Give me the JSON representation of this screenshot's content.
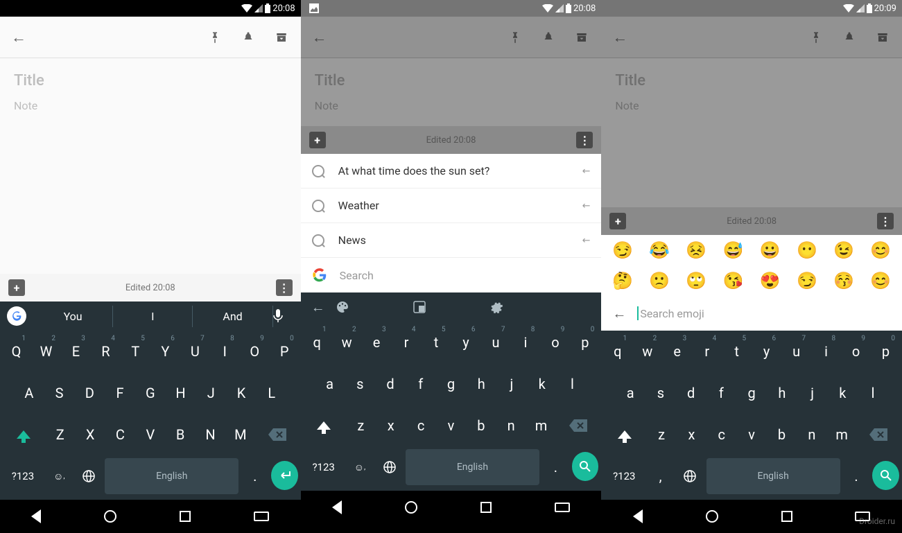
{
  "status": {
    "time1": "20:08",
    "time2": "20:08",
    "time3": "20:09"
  },
  "note": {
    "title": "Title",
    "body": "Note",
    "edited": "Edited 20:08"
  },
  "suggestions": {
    "items": [
      "At what time does the sun set?",
      "Weather",
      "News"
    ],
    "search_placeholder": "Search"
  },
  "emoji": {
    "row1": [
      "😏",
      "😂",
      "😣",
      "😅",
      "😀",
      "😶",
      "😉",
      "😊"
    ],
    "row2": [
      "🤔",
      "🙁",
      "🙄",
      "😘",
      "😍",
      "😏",
      "😚",
      "😊"
    ],
    "search_placeholder": "Search emoji"
  },
  "kb": {
    "suggestions": [
      "You",
      "I",
      "And"
    ],
    "row1_upper": [
      "Q",
      "W",
      "E",
      "R",
      "T",
      "Y",
      "U",
      "I",
      "O",
      "P"
    ],
    "row1_lower": [
      "q",
      "w",
      "e",
      "r",
      "t",
      "y",
      "u",
      "i",
      "o",
      "p"
    ],
    "row1_nums": [
      "1",
      "2",
      "3",
      "4",
      "5",
      "6",
      "7",
      "8",
      "9",
      "0"
    ],
    "row2_upper": [
      "A",
      "S",
      "D",
      "F",
      "G",
      "H",
      "J",
      "K",
      "L"
    ],
    "row2_lower": [
      "a",
      "s",
      "d",
      "f",
      "g",
      "h",
      "j",
      "k",
      "l"
    ],
    "row3_upper": [
      "Z",
      "X",
      "C",
      "V",
      "B",
      "N",
      "M"
    ],
    "row3_lower": [
      "z",
      "x",
      "c",
      "v",
      "b",
      "n",
      "m"
    ],
    "symbols": "?123",
    "space": "English",
    "period": ".",
    "comma": ","
  },
  "watermark": "Droider.ru"
}
